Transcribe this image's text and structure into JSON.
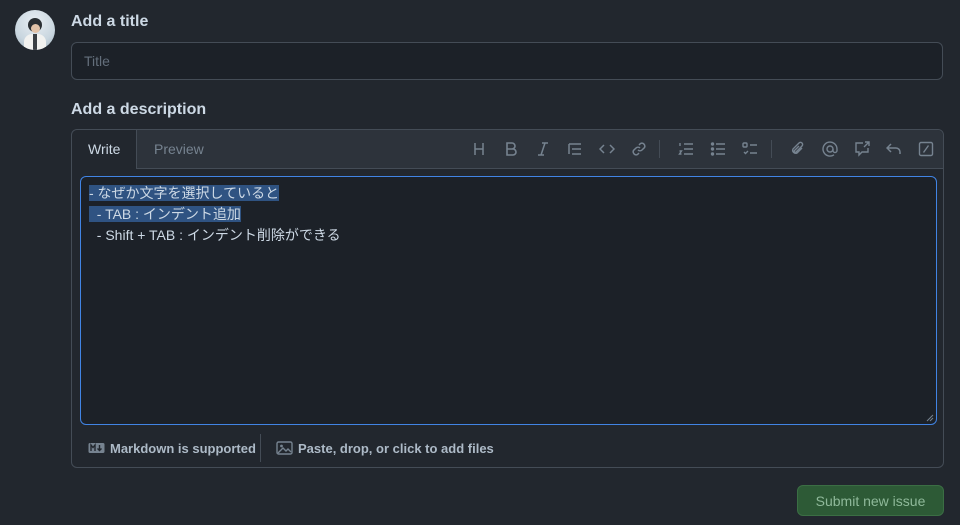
{
  "title_section": {
    "label": "Add a title",
    "placeholder": "Title"
  },
  "description_section": {
    "label": "Add a description"
  },
  "editor": {
    "tabs": [
      {
        "label": "Write"
      },
      {
        "label": "Preview"
      }
    ],
    "toolbar": [
      "heading-icon",
      "bold-icon",
      "italic-icon",
      "quote-icon",
      "code-icon",
      "link-icon",
      "numbered-list-icon",
      "unordered-list-icon",
      "task-list-icon",
      "attach-icon",
      "mention-icon",
      "reference-icon",
      "undo-icon",
      "slash-command-icon"
    ],
    "lines": [
      "- なぜか文字を選択していると",
      "  - TAB : インデント追加",
      "  - Shift + TAB : インデント削除ができる"
    ],
    "selected_lines": [
      0,
      1
    ],
    "footer": {
      "markdown": "Markdown is supported",
      "files": "Paste, drop, or click to add files"
    }
  },
  "submit": {
    "label": "Submit new issue"
  },
  "colors": {
    "accent": "#4184e4",
    "selection": "#2f5382",
    "submit_bg": "#2d5a36"
  }
}
